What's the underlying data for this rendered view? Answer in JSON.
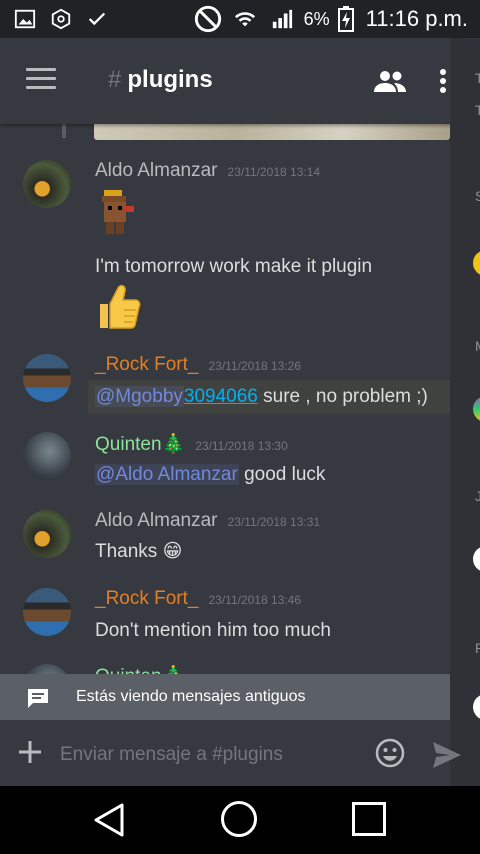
{
  "status_bar": {
    "battery_percent": "6%",
    "time": "11:16 p.m.",
    "icons": [
      "image-icon",
      "sync-icon",
      "check-icon",
      "do-not-disturb-icon",
      "wifi-icon",
      "signal-icon",
      "battery-charging-icon"
    ]
  },
  "header": {
    "hash": "#",
    "channel": "plugins",
    "icons": [
      "menu-icon",
      "members-icon",
      "more-icon"
    ]
  },
  "messages": [
    {
      "author": "Aldo Almanzar",
      "timestamp": "23/11/2018 13:14",
      "text": "",
      "color": "#b9bbbe"
    },
    {
      "author": "",
      "timestamp": "",
      "text": "I'm tomorrow work make it plugin",
      "color": "#b9bbbe"
    },
    {
      "author": "_Rock Fort_",
      "timestamp": "23/11/2018 13:26",
      "mention": "@Mgobby",
      "link": "3094066",
      "text": " sure , no problem ;)",
      "color": "#e67e22"
    },
    {
      "author": "Quinten🎄",
      "timestamp": "23/11/2018 13:30",
      "mention": "@Aldo Almanzar",
      "text": " good luck",
      "color": "#8ee29c"
    },
    {
      "author": "Aldo Almanzar",
      "timestamp": "23/11/2018 13:31",
      "text": "Thanks",
      "emoji": "😁",
      "color": "#b9bbbe"
    },
    {
      "author": "_Rock Fort_",
      "timestamp": "23/11/2018 13:46",
      "text": "Don't mention him too much",
      "color": "#e67e22"
    },
    {
      "author": "Quinten🎄",
      "timestamp": "",
      "text": "",
      "color": "#8ee29c"
    }
  ],
  "old_messages_banner": "Estás viendo mensajes antiguos",
  "composer": {
    "placeholder": "Enviar mensaje a #plugins"
  },
  "accent": "#7289da"
}
